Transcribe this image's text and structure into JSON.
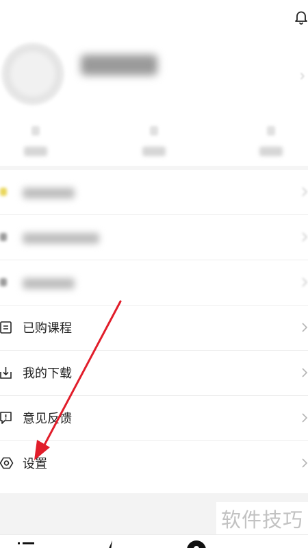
{
  "header": {
    "bell_icon": "bell-icon"
  },
  "menu": {
    "items": [
      {
        "label": "已购课程",
        "icon": "list-icon"
      },
      {
        "label": "我的下载",
        "icon": "download-icon"
      },
      {
        "label": "意见反馈",
        "icon": "feedback-icon"
      },
      {
        "label": "设置",
        "icon": "hexagon-settings-icon"
      }
    ]
  },
  "watermark": {
    "text": "软件技巧"
  },
  "colors": {
    "annotation_arrow": "#e11d2a",
    "divider": "#ededed",
    "page_bg": "#ffffff"
  }
}
